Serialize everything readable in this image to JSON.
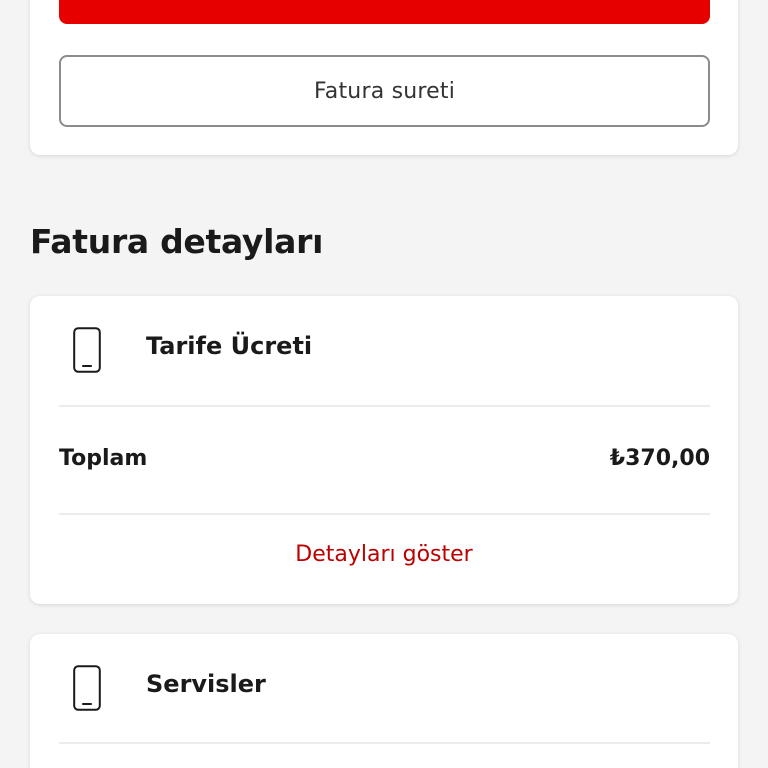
{
  "top_card": {
    "primary_button_label": "",
    "secondary_button_label": "Fatura sureti"
  },
  "section": {
    "title": "Fatura detayları"
  },
  "tarife_card": {
    "icon": "mobile-phone-icon",
    "title": "Tarife Ücreti",
    "total_label": "Toplam",
    "total_value": "₺370,00",
    "details_link": "Detayları göster"
  },
  "servisler_card": {
    "icon": "mobile-phone-icon",
    "title": "Servisler"
  },
  "colors": {
    "brand_red": "#e60000",
    "link_red": "#bd0000",
    "background": "#f4f4f4"
  }
}
